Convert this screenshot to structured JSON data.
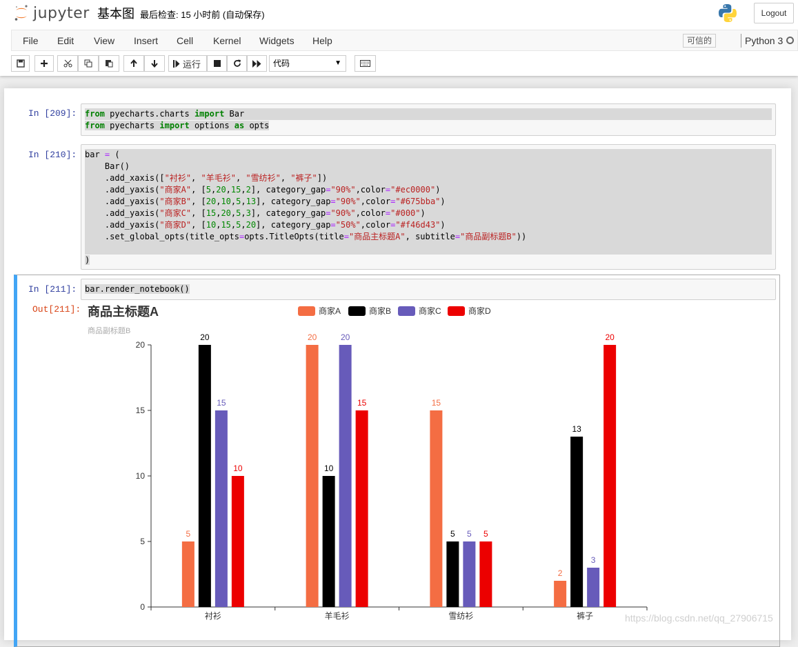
{
  "header": {
    "logo_text": "jupyter",
    "notebook_title": "基本图",
    "checkpoint": "最后检查: 15 小时前  (自动保存)",
    "logout_label": "Logout"
  },
  "menubar": {
    "items": [
      "File",
      "Edit",
      "View",
      "Insert",
      "Cell",
      "Kernel",
      "Widgets",
      "Help"
    ],
    "trusted": "可信的",
    "kernel": "Python 3"
  },
  "toolbar": {
    "run_label": "运行",
    "cell_type": "代码",
    "icons": [
      "save-icon",
      "plus-icon",
      "cut-icon",
      "copy-icon",
      "paste-icon",
      "arrow-up-icon",
      "arrow-down-icon",
      "step-forward-icon",
      "stop-icon",
      "restart-icon",
      "fast-forward-icon",
      "keyboard-icon"
    ]
  },
  "cells": [
    {
      "prompt": "In  [209]:",
      "lines": [
        "from pyecharts.charts import Bar",
        "from pyecharts import options as opts"
      ]
    },
    {
      "prompt": "In  [210]:",
      "lines": [
        "bar = (",
        "    Bar()",
        "    .add_xaxis([\"衬衫\", \"羊毛衫\", \"雪纺衫\", \"裤子\"])",
        "    .add_yaxis(\"商家A\", [5,20,15,2], category_gap=\"90%\",color=\"#ec0000\")",
        "    .add_yaxis(\"商家B\", [20,10,5,13], category_gap=\"90%\",color=\"#675bba\")",
        "    .add_yaxis(\"商家C\", [15,20,5,3], category_gap=\"90%\",color=\"#000\")",
        "    .add_yaxis(\"商家D\", [10,15,5,20], category_gap=\"50%\",color=\"#f46d43\")",
        "    .set_global_opts(title_opts=opts.TitleOpts(title=\"商品主标题A\", subtitle=\"商品副标题B\"))",
        "",
        ")"
      ]
    },
    {
      "prompt": "In  [211]:",
      "lines": [
        "bar.render_notebook()"
      ],
      "out_prompt": "Out[211]:"
    }
  ],
  "chart_data": {
    "type": "bar",
    "title": "商品主标题A",
    "subtitle": "商品副标题B",
    "categories": [
      "衬衫",
      "羊毛衫",
      "雪纺衫",
      "裤子"
    ],
    "series": [
      {
        "name": "商家A",
        "color": "#f46d43",
        "values": [
          5,
          20,
          15,
          2
        ]
      },
      {
        "name": "商家B",
        "color": "#000000",
        "values": [
          20,
          10,
          5,
          13
        ]
      },
      {
        "name": "商家C",
        "color": "#675bba",
        "values": [
          15,
          20,
          5,
          3
        ]
      },
      {
        "name": "商家D",
        "color": "#ec0000",
        "values": [
          10,
          15,
          5,
          20
        ]
      }
    ],
    "ylim": [
      0,
      20
    ],
    "yticks": [
      0,
      5,
      10,
      15,
      20
    ],
    "legend_position": "top",
    "grid": false
  },
  "watermark": "https://blog.csdn.net/qq_27906715"
}
